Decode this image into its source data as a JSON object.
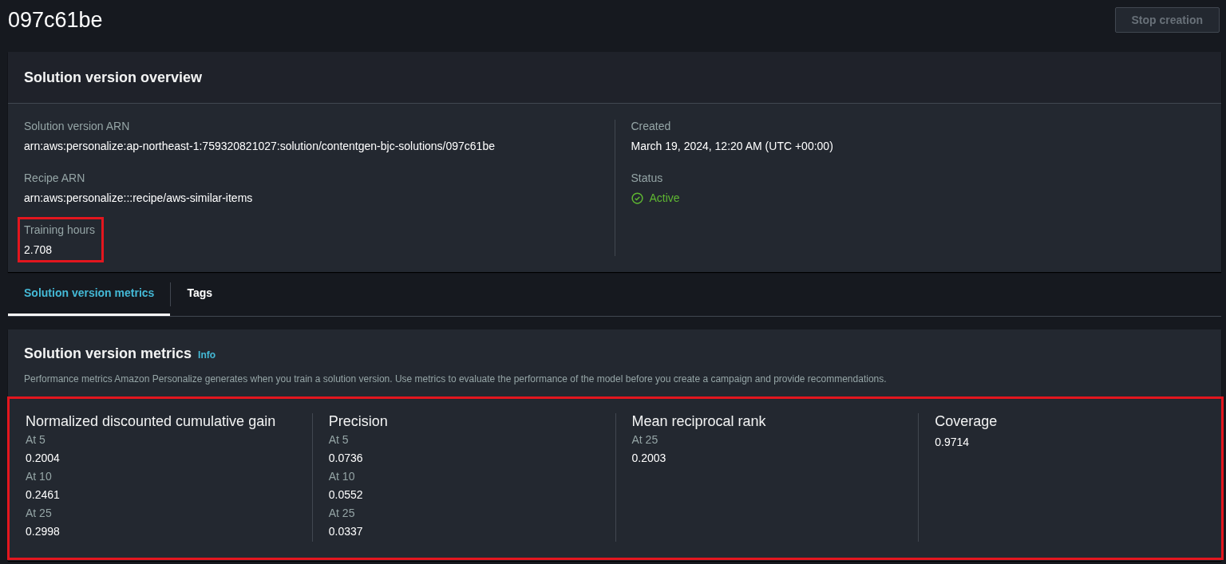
{
  "page": {
    "title": "097c61be",
    "action_button": {
      "label": "Stop creation",
      "disabled": true
    }
  },
  "overview": {
    "title": "Solution version overview",
    "columns": [
      [
        {
          "label": "Solution version ARN",
          "value": "arn:aws:personalize:ap-northeast-1:759320821027:solution/contentgen-bjc-solutions/097c61be",
          "highlighted": false
        },
        {
          "label": "Recipe ARN",
          "value": "arn:aws:personalize:::recipe/aws-similar-items",
          "highlighted": false
        },
        {
          "label": "Training hours",
          "value": "2.708",
          "highlighted": true
        }
      ],
      [
        {
          "label": "Created",
          "value": "March 19, 2024, 12:20 AM (UTC +00:00)",
          "highlighted": false
        },
        {
          "label": "Status",
          "value": "Active",
          "kind": "status-success",
          "highlighted": false
        }
      ]
    ]
  },
  "tabs": [
    {
      "label": "Solution version metrics",
      "selected": true
    },
    {
      "label": "Tags",
      "selected": false
    }
  ],
  "metrics": {
    "title": "Solution version metrics",
    "info_link": "Info",
    "description": "Performance metrics Amazon Personalize generates when you train a solution version. Use metrics to evaluate the performance of the model before you create a campaign and provide recommendations.",
    "highlighted": true,
    "groups": [
      {
        "name": "Normalized discounted cumulative gain",
        "entries": [
          {
            "label": "At 5",
            "value": "0.2004"
          },
          {
            "label": "At 10",
            "value": "0.2461"
          },
          {
            "label": "At 25",
            "value": "0.2998"
          }
        ]
      },
      {
        "name": "Precision",
        "entries": [
          {
            "label": "At 5",
            "value": "0.0736"
          },
          {
            "label": "At 10",
            "value": "0.0552"
          },
          {
            "label": "At 25",
            "value": "0.0337"
          }
        ]
      },
      {
        "name": "Mean reciprocal rank",
        "entries": [
          {
            "label": "At 25",
            "value": "0.2003"
          }
        ]
      },
      {
        "name": "Coverage",
        "entries": [
          {
            "value": "0.9714"
          }
        ]
      }
    ]
  }
}
